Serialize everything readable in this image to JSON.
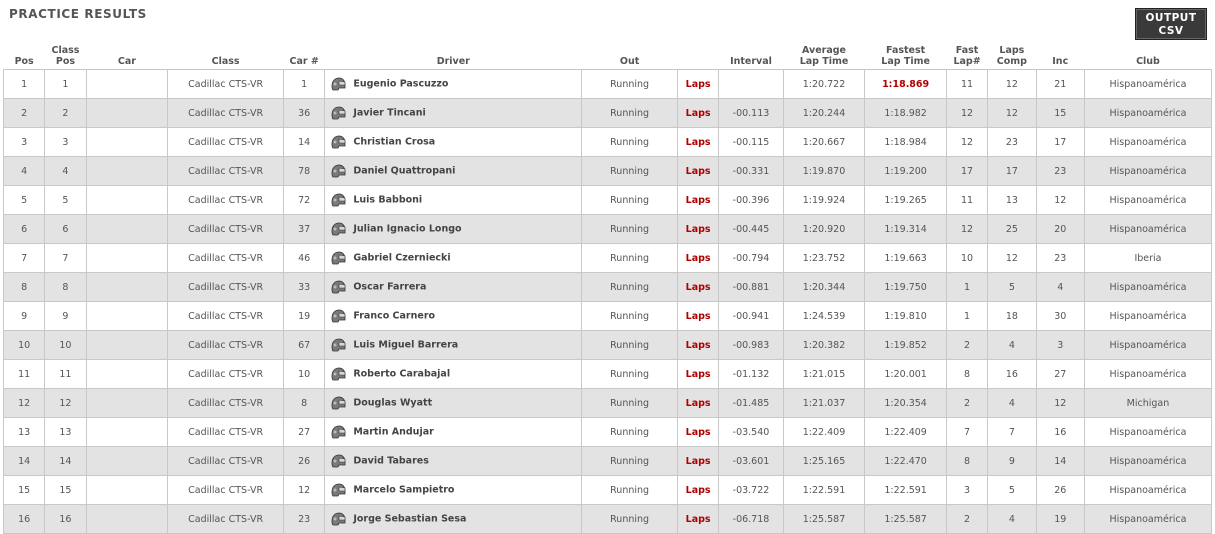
{
  "page": {
    "title": "PRACTICE RESULTS"
  },
  "toolbar": {
    "csv_line1": "OUTPUT",
    "csv_line2": "CSV"
  },
  "columns": {
    "pos": "Pos",
    "class_pos_1": "Class",
    "class_pos_2": "Pos",
    "car": "Car",
    "class": "Class",
    "car_num": "Car #",
    "driver": "Driver",
    "out": "Out",
    "laps": "",
    "interval": "Interval",
    "avg_1": "Average",
    "avg_2": "Lap Time",
    "fast_1": "Fastest",
    "fast_2": "Lap Time",
    "fastlap_1": "Fast",
    "fastlap_2": "Lap#",
    "comp_1": "Laps",
    "comp_2": "Comp",
    "inc": "Inc",
    "club": "Club"
  },
  "colors": {
    "accent_red": "#b00000",
    "row_alt": "#e3e3e3",
    "button_bg": "#3a3a3a"
  },
  "icons": {
    "driver_helmet": "helmet-icon"
  },
  "rows": [
    {
      "pos": "1",
      "class_pos": "1",
      "car": "",
      "class": "Cadillac CTS-VR",
      "car_num": "1",
      "driver": "Eugenio Pascuzzo",
      "out": "Running",
      "laps": "Laps",
      "interval": "",
      "avg": "1:20.722",
      "fastest": "1:18.869",
      "fast_lap": "11",
      "laps_comp": "12",
      "inc": "21",
      "club": "Hispanoamérica"
    },
    {
      "pos": "2",
      "class_pos": "2",
      "car": "",
      "class": "Cadillac CTS-VR",
      "car_num": "36",
      "driver": "Javier Tincani",
      "out": "Running",
      "laps": "Laps",
      "interval": "-00.113",
      "avg": "1:20.244",
      "fastest": "1:18.982",
      "fast_lap": "12",
      "laps_comp": "12",
      "inc": "15",
      "club": "Hispanoamérica"
    },
    {
      "pos": "3",
      "class_pos": "3",
      "car": "",
      "class": "Cadillac CTS-VR",
      "car_num": "14",
      "driver": "Christian Crosa",
      "out": "Running",
      "laps": "Laps",
      "interval": "-00.115",
      "avg": "1:20.667",
      "fastest": "1:18.984",
      "fast_lap": "12",
      "laps_comp": "23",
      "inc": "17",
      "club": "Hispanoamérica"
    },
    {
      "pos": "4",
      "class_pos": "4",
      "car": "",
      "class": "Cadillac CTS-VR",
      "car_num": "78",
      "driver": "Daniel Quattropani",
      "out": "Running",
      "laps": "Laps",
      "interval": "-00.331",
      "avg": "1:19.870",
      "fastest": "1:19.200",
      "fast_lap": "17",
      "laps_comp": "17",
      "inc": "23",
      "club": "Hispanoamérica"
    },
    {
      "pos": "5",
      "class_pos": "5",
      "car": "",
      "class": "Cadillac CTS-VR",
      "car_num": "72",
      "driver": "Luis Babboni",
      "out": "Running",
      "laps": "Laps",
      "interval": "-00.396",
      "avg": "1:19.924",
      "fastest": "1:19.265",
      "fast_lap": "11",
      "laps_comp": "13",
      "inc": "12",
      "club": "Hispanoamérica"
    },
    {
      "pos": "6",
      "class_pos": "6",
      "car": "",
      "class": "Cadillac CTS-VR",
      "car_num": "37",
      "driver": "Julian Ignacio Longo",
      "out": "Running",
      "laps": "Laps",
      "interval": "-00.445",
      "avg": "1:20.920",
      "fastest": "1:19.314",
      "fast_lap": "12",
      "laps_comp": "25",
      "inc": "20",
      "club": "Hispanoamérica"
    },
    {
      "pos": "7",
      "class_pos": "7",
      "car": "",
      "class": "Cadillac CTS-VR",
      "car_num": "46",
      "driver": "Gabriel Czerniecki",
      "out": "Running",
      "laps": "Laps",
      "interval": "-00.794",
      "avg": "1:23.752",
      "fastest": "1:19.663",
      "fast_lap": "10",
      "laps_comp": "12",
      "inc": "23",
      "club": "Iberia"
    },
    {
      "pos": "8",
      "class_pos": "8",
      "car": "",
      "class": "Cadillac CTS-VR",
      "car_num": "33",
      "driver": "Oscar Farrera",
      "out": "Running",
      "laps": "Laps",
      "interval": "-00.881",
      "avg": "1:20.344",
      "fastest": "1:19.750",
      "fast_lap": "1",
      "laps_comp": "5",
      "inc": "4",
      "club": "Hispanoamérica"
    },
    {
      "pos": "9",
      "class_pos": "9",
      "car": "",
      "class": "Cadillac CTS-VR",
      "car_num": "19",
      "driver": "Franco Carnero",
      "out": "Running",
      "laps": "Laps",
      "interval": "-00.941",
      "avg": "1:24.539",
      "fastest": "1:19.810",
      "fast_lap": "1",
      "laps_comp": "18",
      "inc": "30",
      "club": "Hispanoamérica"
    },
    {
      "pos": "10",
      "class_pos": "10",
      "car": "",
      "class": "Cadillac CTS-VR",
      "car_num": "67",
      "driver": "Luis Miguel Barrera",
      "out": "Running",
      "laps": "Laps",
      "interval": "-00.983",
      "avg": "1:20.382",
      "fastest": "1:19.852",
      "fast_lap": "2",
      "laps_comp": "4",
      "inc": "3",
      "club": "Hispanoamérica"
    },
    {
      "pos": "11",
      "class_pos": "11",
      "car": "",
      "class": "Cadillac CTS-VR",
      "car_num": "10",
      "driver": "Roberto Carabajal",
      "out": "Running",
      "laps": "Laps",
      "interval": "-01.132",
      "avg": "1:21.015",
      "fastest": "1:20.001",
      "fast_lap": "8",
      "laps_comp": "16",
      "inc": "27",
      "club": "Hispanoamérica"
    },
    {
      "pos": "12",
      "class_pos": "12",
      "car": "",
      "class": "Cadillac CTS-VR",
      "car_num": "8",
      "driver": "Douglas Wyatt",
      "out": "Running",
      "laps": "Laps",
      "interval": "-01.485",
      "avg": "1:21.037",
      "fastest": "1:20.354",
      "fast_lap": "2",
      "laps_comp": "4",
      "inc": "12",
      "club": "Michigan"
    },
    {
      "pos": "13",
      "class_pos": "13",
      "car": "",
      "class": "Cadillac CTS-VR",
      "car_num": "27",
      "driver": "Martin Andujar",
      "out": "Running",
      "laps": "Laps",
      "interval": "-03.540",
      "avg": "1:22.409",
      "fastest": "1:22.409",
      "fast_lap": "7",
      "laps_comp": "7",
      "inc": "16",
      "club": "Hispanoamérica"
    },
    {
      "pos": "14",
      "class_pos": "14",
      "car": "",
      "class": "Cadillac CTS-VR",
      "car_num": "26",
      "driver": "David Tabares",
      "out": "Running",
      "laps": "Laps",
      "interval": "-03.601",
      "avg": "1:25.165",
      "fastest": "1:22.470",
      "fast_lap": "8",
      "laps_comp": "9",
      "inc": "14",
      "club": "Hispanoamérica"
    },
    {
      "pos": "15",
      "class_pos": "15",
      "car": "",
      "class": "Cadillac CTS-VR",
      "car_num": "12",
      "driver": "Marcelo Sampietro",
      "out": "Running",
      "laps": "Laps",
      "interval": "-03.722",
      "avg": "1:22.591",
      "fastest": "1:22.591",
      "fast_lap": "3",
      "laps_comp": "5",
      "inc": "26",
      "club": "Hispanoamérica"
    },
    {
      "pos": "16",
      "class_pos": "16",
      "car": "",
      "class": "Cadillac CTS-VR",
      "car_num": "23",
      "driver": "Jorge Sebastian Sesa",
      "out": "Running",
      "laps": "Laps",
      "interval": "-06.718",
      "avg": "1:25.587",
      "fastest": "1:25.587",
      "fast_lap": "2",
      "laps_comp": "4",
      "inc": "19",
      "club": "Hispanoamérica"
    }
  ]
}
